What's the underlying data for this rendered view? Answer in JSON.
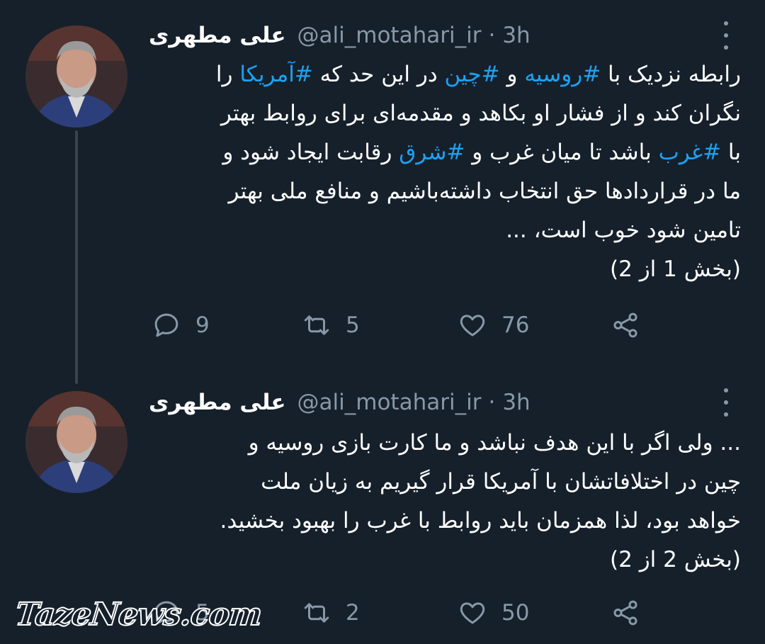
{
  "tweets": [
    {
      "name": "علی مطهری",
      "handle": "@ali_motahari_ir",
      "separator": "·",
      "time": "3h",
      "lines": [
        [
          "رابطه نزدیک با ",
          {
            "tag": "#روسیه"
          },
          " و ",
          {
            "tag": "#چین"
          },
          " در این حد که ",
          {
            "tag": "#آمریکا"
          },
          " را"
        ],
        [
          "نگران کند و از فشار او بکاهد و مقدمه‌ای برای روابط بهتر"
        ],
        [
          "با ",
          {
            "tag": "#غرب"
          },
          " باشد تا میان غرب و ",
          {
            "tag": "#شرق"
          },
          " رقابت ایجاد شود و"
        ],
        [
          "ما در قراردادها حق انتخاب داشته‌باشیم و منافع ملی بهتر"
        ],
        [
          "تامین شود خوب است، ..."
        ],
        [
          "(بخش 1 از 2)"
        ]
      ],
      "text": {
        "l1a": "رابطه نزدیک با ",
        "t1": "#روسیه",
        "l1b": " و ",
        "t2": "#چین",
        "l1c": " در این حد که ",
        "t3": "#آمریکا",
        "l1d": " را",
        "l2": "نگران کند و از فشار او بکاهد و مقدمه‌ای برای روابط بهتر",
        "l3a": "با ",
        "t4": "#غرب",
        "l3b": " باشد تا میان غرب و ",
        "t5": "#شرق",
        "l3c": " رقابت ایجاد شود و",
        "l4": "ما در قراردادها حق انتخاب داشته‌باشیم و منافع ملی بهتر",
        "l5": "تامین شود خوب است، ...",
        "l6": "(بخش 1 از 2)"
      },
      "replies": "9",
      "retweets": "5",
      "likes": "76"
    },
    {
      "name": "علی مطهری",
      "handle": "@ali_motahari_ir",
      "separator": "·",
      "time": "3h",
      "text": {
        "l1": "... ولی اگر با این هدف نباشد و ما کارت بازی روسیه و",
        "l2": "چین در اختلافاتشان با آمریکا قرار گیریم به زیان ملت",
        "l3": "خواهد بود، لذا همزمان باید روابط با غرب را بهبود بخشید.",
        "l4": "(بخش 2 از 2)"
      },
      "replies": "5",
      "retweets": "2",
      "likes": "50"
    }
  ],
  "watermark": "TazeNews.com",
  "icons": {
    "reply": "reply-icon",
    "retweet": "retweet-icon",
    "like": "heart-icon",
    "share": "share-icon",
    "more": "more-vertical-icon"
  },
  "colors": {
    "background": "#15202b",
    "hashtag": "#1da1f2",
    "secondary_text": "#8899a6",
    "thread_line": "#38444d"
  }
}
